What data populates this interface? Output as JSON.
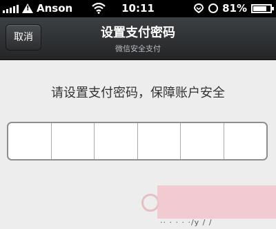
{
  "status_bar": {
    "carrier": "Anson",
    "time": "10:11",
    "battery_percent": "81%",
    "battery_level": 0.81
  },
  "nav": {
    "cancel_label": "取消",
    "title": "设置支付密码",
    "subtitle": "微信安全支付"
  },
  "prompt": "请设置支付密码，保障账户安全",
  "pin": {
    "length": 6
  },
  "watermark": {
    "text": "·· · · · ·/y / /"
  }
}
